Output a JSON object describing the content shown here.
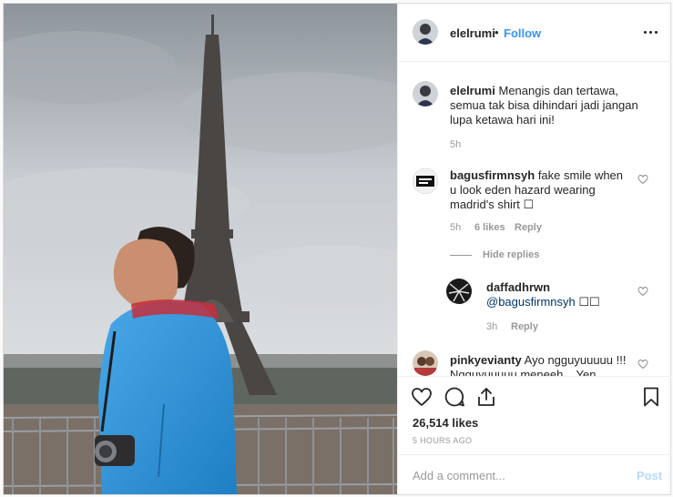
{
  "header": {
    "username": "elelrumi",
    "separator": "•",
    "follow_label": "Follow",
    "more_icon": "more-horizontal-icon"
  },
  "comments": [
    {
      "username": "elelrumi",
      "text": "Menangis dan tertawa, semua tak bisa dihindari jadi jangan lupa ketawa hari ini!",
      "time": "5h"
    },
    {
      "username": "bagusfirmnsyh",
      "text": "fake smile when u look eden hazard wearing madrid's shirt ☐",
      "time": "5h",
      "likes": "6 likes",
      "reply_label": "Reply",
      "hide_replies": "Hide replies"
    },
    {
      "username": "daffadhrwn",
      "mention": "@bagusfirmnsyh",
      "text": "☐☐",
      "time": "3h",
      "reply_label": "Reply"
    },
    {
      "username": "pinkyevianty",
      "text": "Ayo ngguyuuuuu !!! Ngguyuuuuu meneeh... Yen"
    }
  ],
  "actions": {
    "likes": "26,514 likes",
    "timestamp": "5 HOURS AGO",
    "comment_placeholder": "Add a comment...",
    "post_label": "Post"
  },
  "colors": {
    "link": "#3897f0",
    "post_disabled": "#b3dbff",
    "meta": "#999999"
  }
}
